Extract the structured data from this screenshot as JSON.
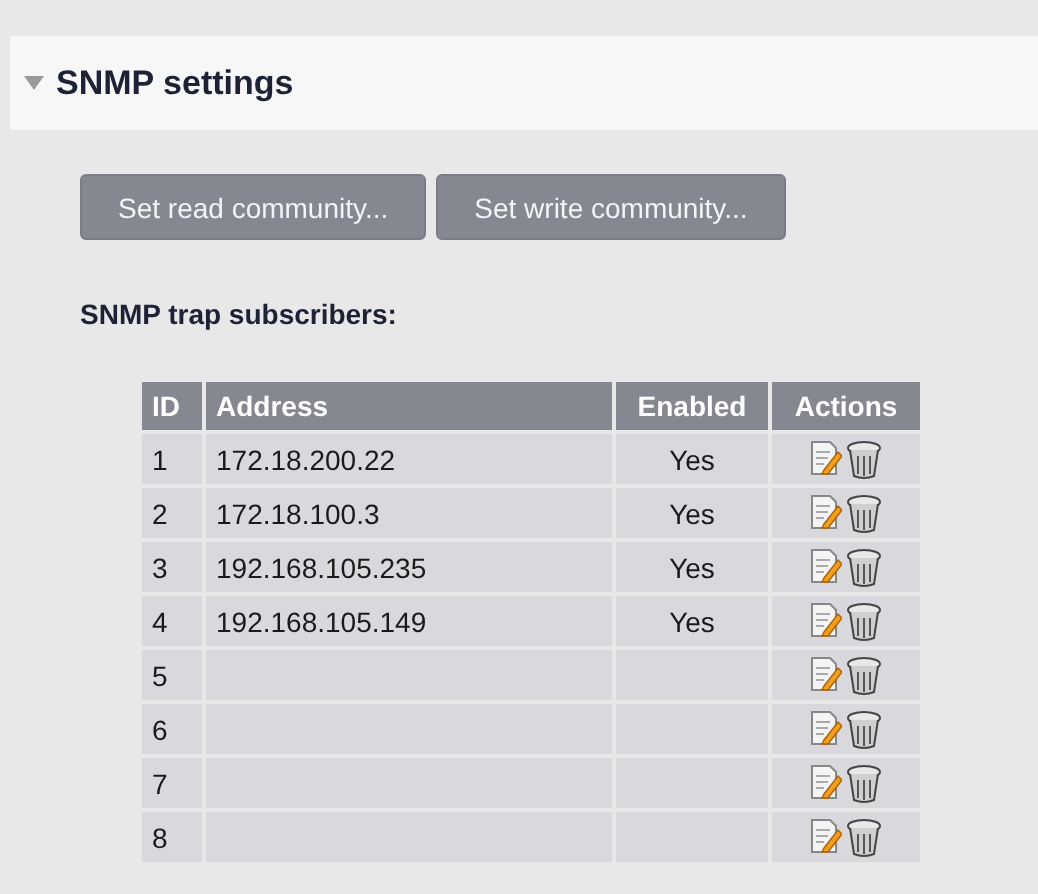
{
  "section": {
    "title": "SNMP settings",
    "expanded": true
  },
  "buttons": [
    "Set read community...",
    "Set write community..."
  ],
  "subtitle": "SNMP trap subscribers:",
  "table": {
    "columns": [
      "ID",
      "Address",
      "Enabled",
      "Actions"
    ],
    "rows": [
      {
        "id": "1",
        "address": "172.18.200.22",
        "enabled": "Yes"
      },
      {
        "id": "2",
        "address": "172.18.100.3",
        "enabled": "Yes"
      },
      {
        "id": "3",
        "address": "192.168.105.235",
        "enabled": "Yes"
      },
      {
        "id": "4",
        "address": "192.168.105.149",
        "enabled": "Yes"
      },
      {
        "id": "5"
      },
      {
        "id": "6"
      },
      {
        "id": "7"
      },
      {
        "id": "8"
      }
    ]
  }
}
